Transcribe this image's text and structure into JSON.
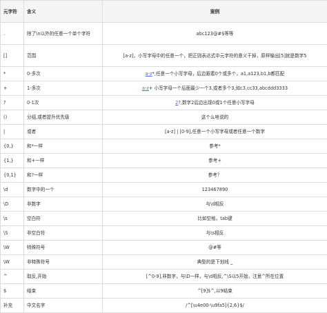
{
  "table": {
    "headers": [
      "元字符",
      "含义",
      "案例"
    ],
    "rows": [
      {
        "symbol": ".",
        "meaning": "除了\\n以外的任意一个单个字符",
        "example": "abc123@#$等等",
        "tall": true
      },
      {
        "symbol": "[]",
        "meaning": "范围",
        "example": "[a-z]，小写字母中的任意一个，把正则表达式中元字符的意义干掉，原样输出[5]就是数字5",
        "tall": true
      },
      {
        "symbol": "*",
        "meaning": "0-多次",
        "example": "a-z*,任意一个小写字母，后边跟着0个或多个，a1,a123,b1,b都匹配",
        "highlight": "a-z"
      },
      {
        "symbol": "+",
        "meaning": "1-多次",
        "example": "a-z+ 小写字母一个后面最少一个3,或者多个3,如c3,cc33,abcddd3333",
        "highlight": "a-z"
      },
      {
        "symbol": "?",
        "meaning": "0-1次",
        "example": "2?,数字2后边出现0或1个任意小写字母",
        "highlight": "2"
      },
      {
        "symbol": "()",
        "meaning": "分组,或者提升优先级",
        "example": "这个么啥说的"
      },
      {
        "symbol": "|",
        "meaning": "或者",
        "example": "[a-z] | [0-9],任意一个小写字母或者任意一个数字"
      },
      {
        "symbol": "{0,}",
        "meaning": "和*一样",
        "example": "参考*"
      },
      {
        "symbol": "{1,}",
        "meaning": "和+一样",
        "example": "参考+"
      },
      {
        "symbol": "{0,1}",
        "meaning": "和?一样",
        "example": "参考？"
      },
      {
        "symbol": "\\d",
        "meaning": "数字中的一个",
        "example": "123467890"
      },
      {
        "symbol": "\\D",
        "meaning": "非数字",
        "example": "与\\d相反"
      },
      {
        "symbol": "\\s",
        "meaning": "空白符",
        "example": "比如空格，tab键"
      },
      {
        "symbol": "\\S",
        "meaning": "非空白符",
        "example": "与\\s相反"
      },
      {
        "symbol": "\\W",
        "meaning": "特殊符号",
        "example": "@#等"
      },
      {
        "symbol": "\\W",
        "meaning": "非特殊符号",
        "example": "典型的是下划线 _"
      },
      {
        "symbol": "^",
        "meaning": "取反,开始",
        "example": "[^0-9],非数字，与\\D一样，与\\d相反,^\\S以5开始，注意^所在位置"
      },
      {
        "symbol": "$",
        "meaning": "结束",
        "example": "^[9]$^,以9结束"
      },
      {
        "symbol": "补充",
        "meaning": "中文名字",
        "example": "/^[\\u4e00-\\u9fa5]{2,6}$/"
      }
    ]
  }
}
